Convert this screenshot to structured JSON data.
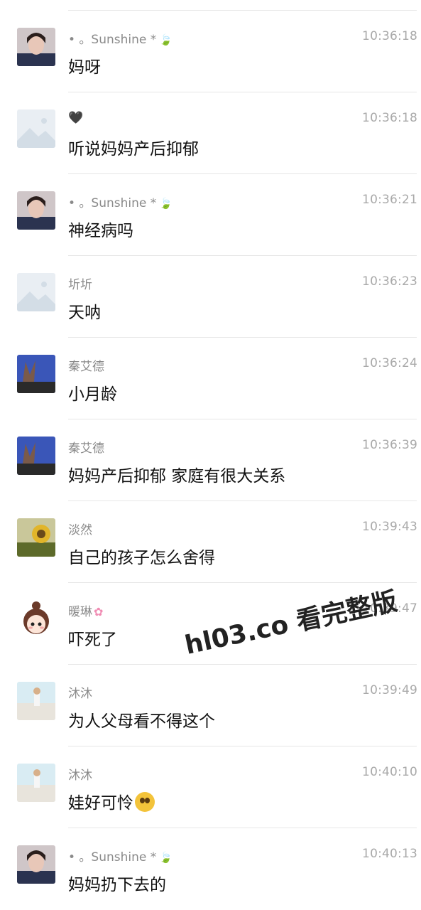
{
  "messages": [
    {
      "name": "• 。Sunshine *",
      "name_suffix": "leaf",
      "time": "10:36:18",
      "text": "妈呀",
      "avatar": "woman-photo"
    },
    {
      "name": "🖤",
      "name_suffix": "",
      "time": "10:36:18",
      "text": "听说妈妈产后抑郁",
      "avatar": "placeholder-image"
    },
    {
      "name": "• 。Sunshine *",
      "name_suffix": "leaf",
      "time": "10:36:21",
      "text": "神经病吗",
      "avatar": "woman-photo"
    },
    {
      "name": "圻圻",
      "name_suffix": "",
      "time": "10:36:23",
      "text": "天呐",
      "avatar": "placeholder-image"
    },
    {
      "name": "秦艾德",
      "name_suffix": "",
      "time": "10:36:24",
      "text": "小月龄",
      "avatar": "hand-sky-photo"
    },
    {
      "name": "秦艾德",
      "name_suffix": "",
      "time": "10:36:39",
      "text": "妈妈产后抑郁 家庭有很大关系",
      "avatar": "hand-sky-photo"
    },
    {
      "name": "淡然",
      "name_suffix": "",
      "time": "10:39:43",
      "text": "自己的孩子怎么舍得",
      "avatar": "sunflower-photo"
    },
    {
      "name": "暖琳",
      "name_suffix": "flower",
      "time": "10:39:47",
      "text": "吓死了",
      "avatar": "cartoon-girl"
    },
    {
      "name": "沐沐",
      "name_suffix": "",
      "time": "10:39:49",
      "text": "为人父母看不得这个",
      "avatar": "beach-child-photo"
    },
    {
      "name": "沐沐",
      "name_suffix": "",
      "time": "10:40:10",
      "text": "娃好可怜",
      "text_emoji": "pleading-face",
      "avatar": "beach-child-photo"
    },
    {
      "name": "• 。Sunshine *",
      "name_suffix": "leaf",
      "time": "10:40:13",
      "text": "妈妈扔下去的",
      "avatar": "woman-photo"
    }
  ],
  "watermark": "hl03.co 看完整版"
}
